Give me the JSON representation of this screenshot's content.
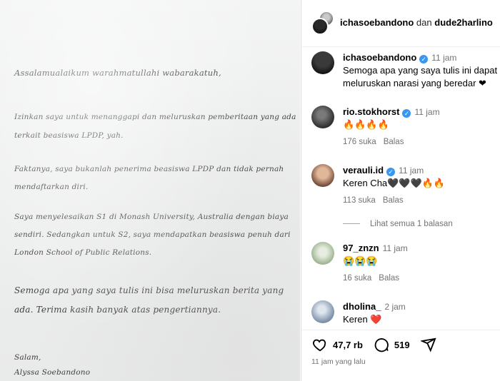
{
  "letter": {
    "greeting": "Assalamualaikum warahmatullahi wabarakatuh,",
    "p1": [
      "Izinkan saya untuk menanggapi dan meluruskan pemberitaan yang ada",
      "terkait beasiswa LPDP, yah."
    ],
    "p2": [
      "Faktanya, saya bukanlah penerima beasiswa LPDP dan tidak pernah",
      "mendaftarkan diri."
    ],
    "p3": [
      "Saya menyelesaikan S1 di Monash University, Australia dengan biaya",
      "sendiri. Sedangkan untuk S2, saya mendapatkan beasiswa penuh dari",
      "London School of Public Relations."
    ],
    "p4": [
      "Semoga apa yang saya tulis ini bisa meluruskan berita yang",
      "ada. Terima kasih banyak atas pengertiannya."
    ],
    "closing": "Salam,",
    "signature": "Alyssa Soebandono"
  },
  "header": {
    "user1": "ichasoebandono",
    "conj": "dan",
    "user2": "dude2harlino"
  },
  "caption": {
    "username": "ichasoebandono",
    "time": "11 jam",
    "text_line1": "Semoga apa yang saya tulis ini dapat",
    "text_line2": "meluruskan narasi yang beredar ❤"
  },
  "comments": [
    {
      "username": "rio.stokhorst",
      "verified": true,
      "time": "11 jam",
      "text": "🔥🔥🔥🔥",
      "likes": "176 suka",
      "reply": "Balas"
    },
    {
      "username": "verauli.id",
      "verified": true,
      "time": "11 jam",
      "text": "Keren Cha🖤🖤🖤🔥🔥",
      "likes": "113 suka",
      "reply": "Balas"
    },
    {
      "username": "97_znzn",
      "verified": false,
      "time": "11 jam",
      "text": "😭😭😭",
      "likes": "16 suka",
      "reply": "Balas"
    },
    {
      "username": "dholina_",
      "verified": false,
      "time": "2 jam",
      "text": "Keren ❤️"
    }
  ],
  "view_replies": "Lihat semua 1 balasan",
  "actions": {
    "likes": "47,7 rb",
    "comments": "519",
    "posted": "11 jam yang lalu"
  }
}
